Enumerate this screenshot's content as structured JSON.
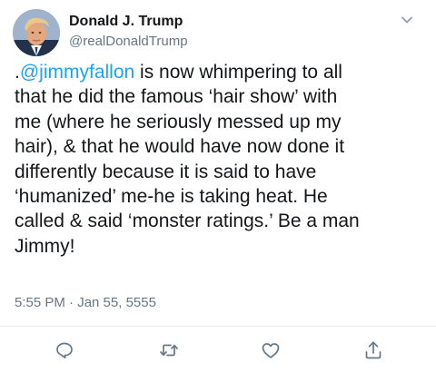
{
  "author": {
    "display_name": "Donald J. Trump",
    "handle": "@realDonaldTrump",
    "avatar_icon": "profile-photo"
  },
  "tweet": {
    "lines": [
      {
        "prefix": ".",
        "mention": "@jimmyfallon",
        "text": " is now whimpering to all"
      },
      {
        "text": "that he did the famous ‘hair show’ with"
      },
      {
        "text": "me (where he seriously messed up my"
      },
      {
        "text": "hair), & that he would have now done it"
      },
      {
        "text": "differently because it is said to have"
      },
      {
        "text": "‘humanized’ me-he is taking heat. He"
      },
      {
        "text": "called & said ‘monster ratings.’ Be a man"
      },
      {
        "text": "Jimmy!"
      }
    ],
    "timestamp": "5:55 PM · Jan 55, 5555"
  },
  "icons": {
    "menu": "chevron-down-icon",
    "reply": "reply-icon",
    "retweet": "retweet-icon",
    "like": "heart-icon",
    "share": "share-icon"
  },
  "colors": {
    "text": "#14171a",
    "secondary": "#657786",
    "mention": "#1da1f2",
    "divider": "#e6ecf0"
  }
}
